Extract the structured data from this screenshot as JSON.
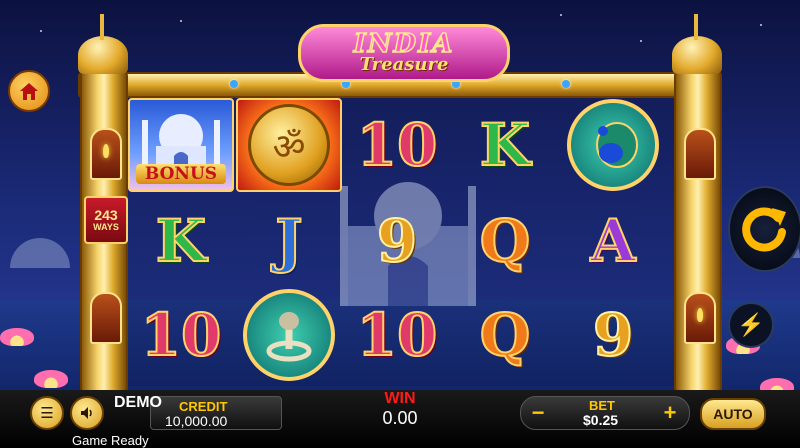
{
  "game": {
    "title_main": "INDIA",
    "title_sub": "Treasure",
    "ways_count": "243",
    "ways_label": "WAYS"
  },
  "reels": {
    "rows": [
      [
        "bonus-taj",
        "om-coin",
        "10",
        "K",
        "peacock"
      ],
      [
        "K",
        "J",
        "9",
        "Q",
        "A"
      ],
      [
        "10",
        "cobra",
        "10",
        "Q",
        "9"
      ]
    ],
    "bonus_label": "BONUS"
  },
  "controls": {
    "demo_label": "DEMO",
    "credit_label": "CREDIT",
    "credit_value": "10,000.00",
    "win_label": "WIN",
    "win_value": "0.00",
    "bet_label": "BET",
    "bet_value": "$0.25",
    "minus": "−",
    "plus": "+",
    "auto_label": "AUTO",
    "status_text": "Game Ready"
  },
  "icons": {
    "home": "home-icon",
    "menu": "menu-icon",
    "sound": "speaker-icon",
    "spin": "spin-arrow-icon",
    "turbo": "lightning-icon"
  },
  "colors": {
    "gold": "#ffc800",
    "frame_gold": "#e0ac30",
    "sky": "#1b2a78"
  }
}
